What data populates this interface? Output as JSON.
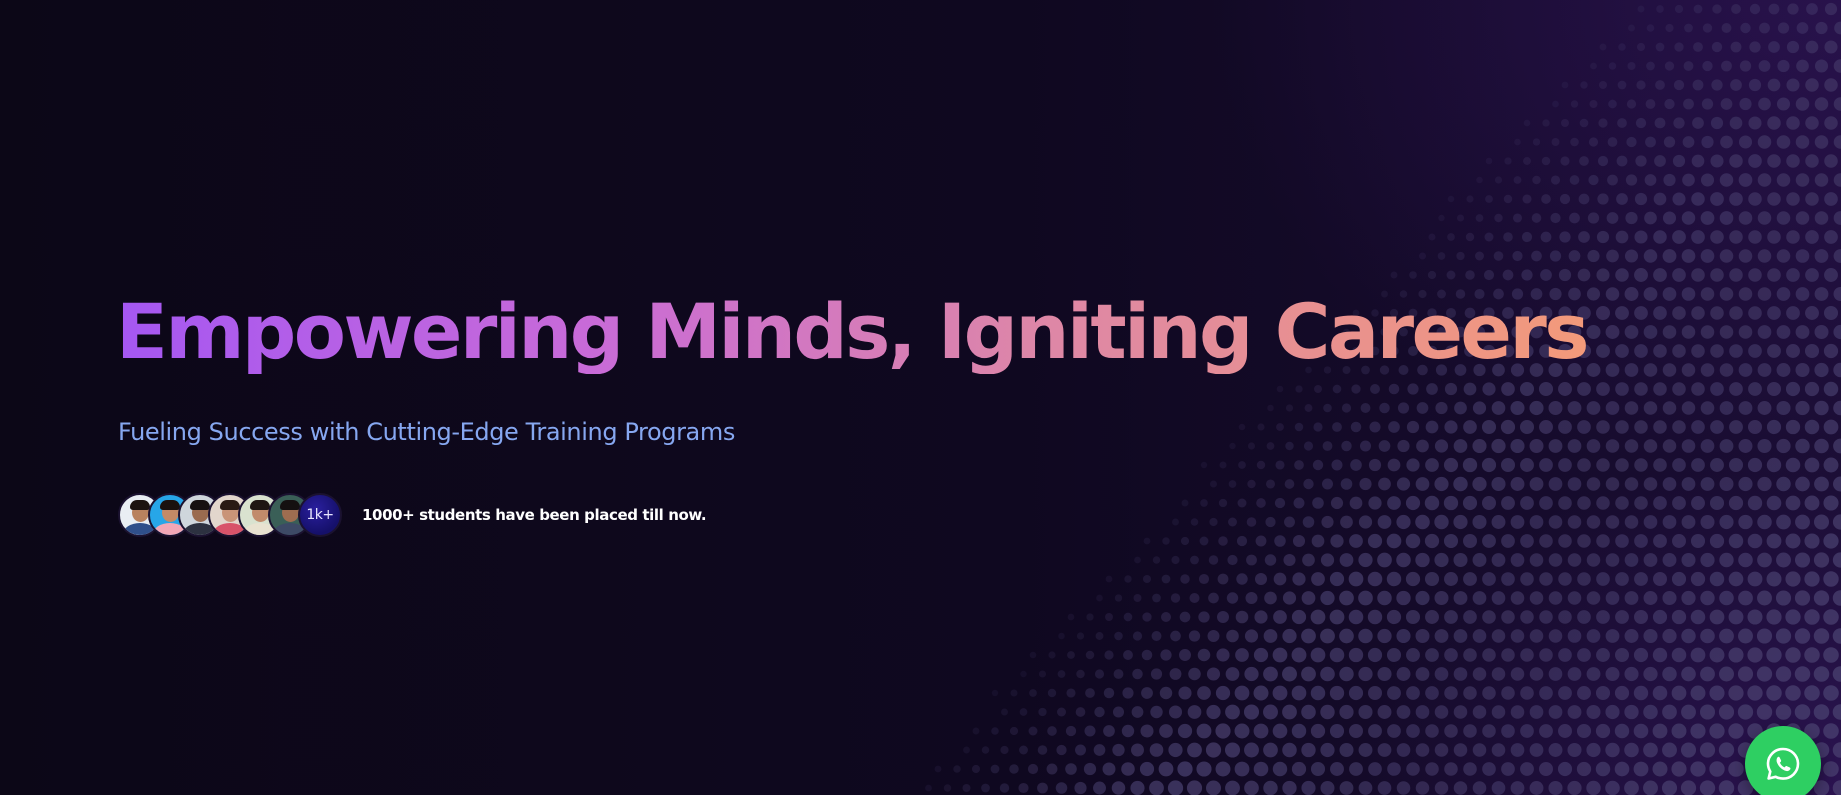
{
  "hero": {
    "headline": "Empowering Minds, Igniting Careers",
    "subheadline": "Fueling Success with Cutting-Edge Training Programs",
    "social_proof": {
      "count_badge": "1k+",
      "text": "1000+ students have been placed till now.",
      "avatars": [
        {
          "name": "student-avatar-1",
          "bg": "#e9eef3",
          "skin": "#b9825e",
          "hair": "#1c1410",
          "shirt": "#2f4f8a"
        },
        {
          "name": "student-avatar-2",
          "bg": "#27a6e8",
          "skin": "#c48a66",
          "hair": "#1a120e",
          "shirt": "#f2a7b6"
        },
        {
          "name": "student-avatar-3",
          "bg": "#cfd6dc",
          "skin": "#9a6b4f",
          "hair": "#161010",
          "shirt": "#2c3140"
        },
        {
          "name": "student-avatar-4",
          "bg": "#e2d6cc",
          "skin": "#c99478",
          "hair": "#2a1a14",
          "shirt": "#d8536a"
        },
        {
          "name": "student-avatar-5",
          "bg": "#d9e2cf",
          "skin": "#c18b6b",
          "hair": "#1f1612",
          "shirt": "#e8e2d0"
        },
        {
          "name": "student-avatar-6",
          "bg": "#3a5f57",
          "skin": "#9e6d50",
          "hair": "#141010",
          "shirt": "#3d4a66"
        }
      ]
    }
  },
  "floating_actions": {
    "whatsapp_icon": "whatsapp-icon"
  },
  "colors": {
    "background": "#0d0818",
    "headline_gradient": [
      "#a557f2",
      "#dd86a8",
      "#f39a7a"
    ],
    "subheadline": "#86a7f0",
    "dots": "#4a4170",
    "count_badge": "#1d1585",
    "whatsapp": "#2ecf62"
  }
}
